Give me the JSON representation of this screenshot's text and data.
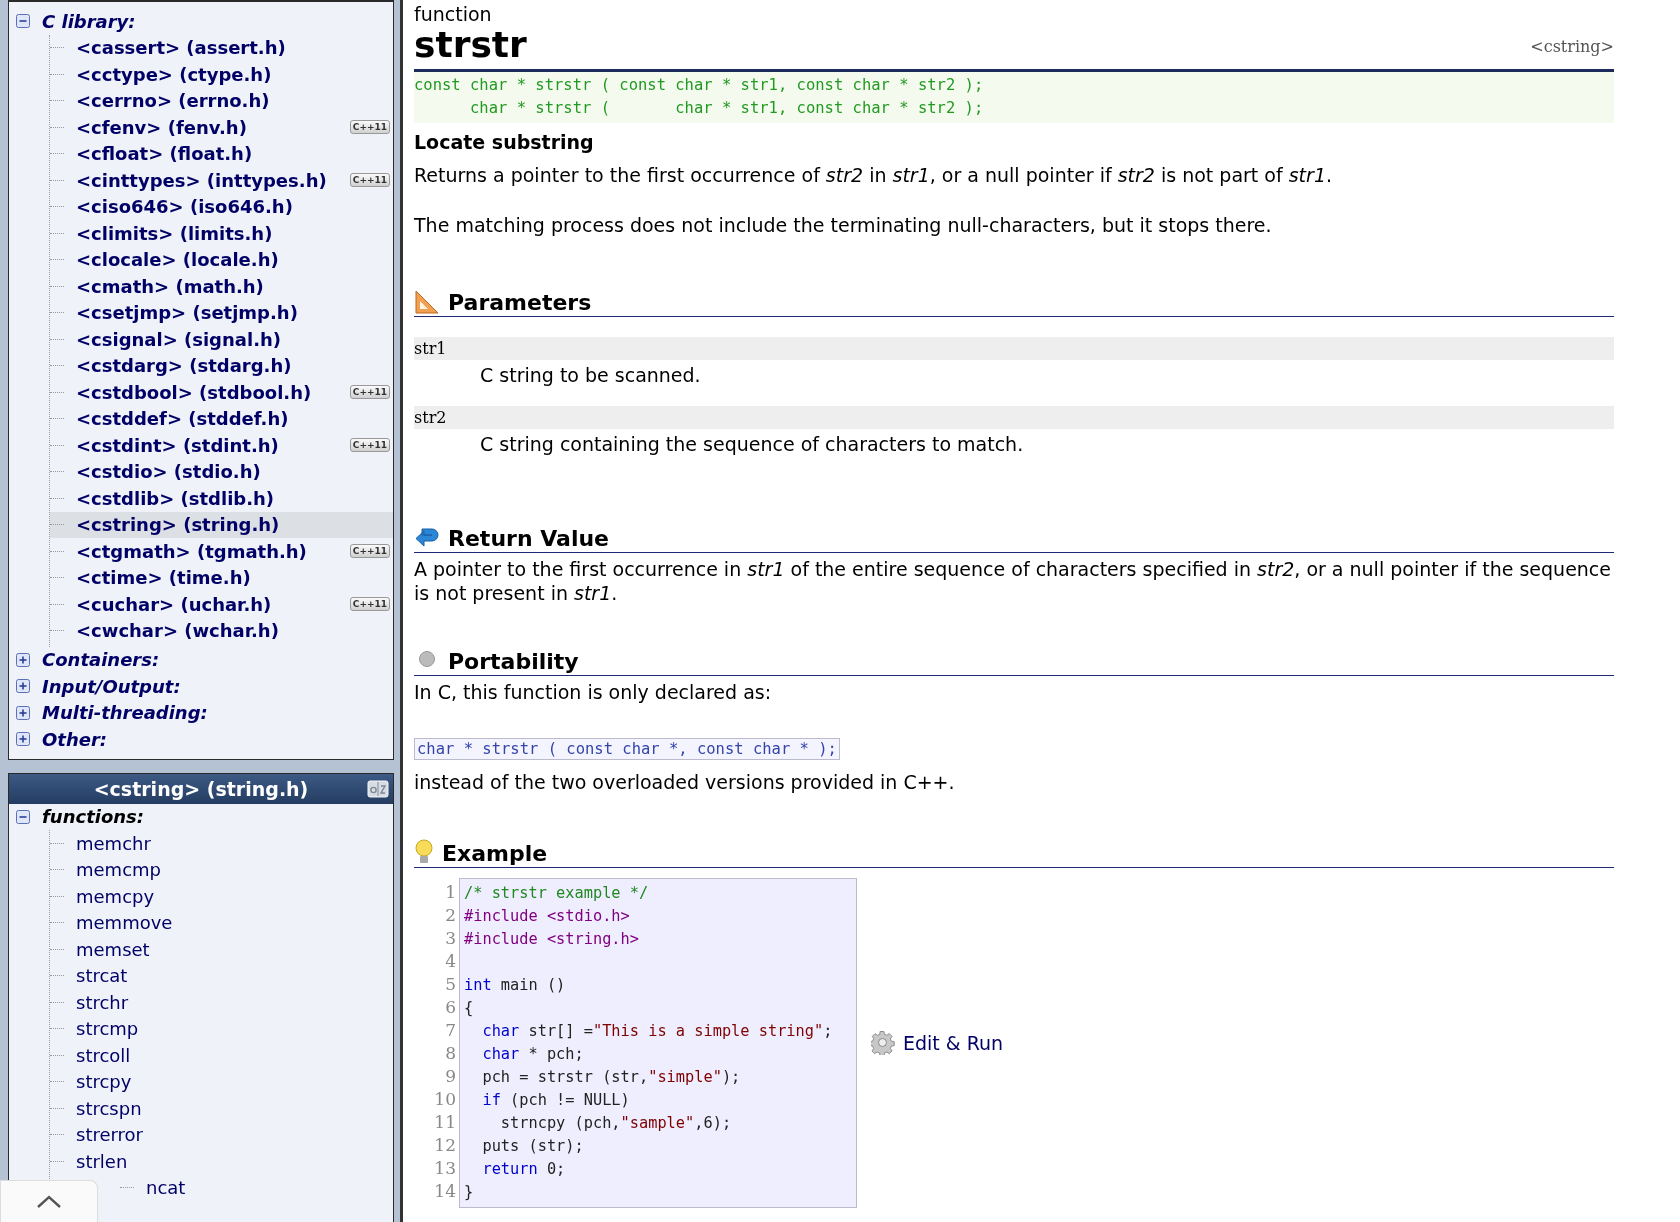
{
  "sidebar": {
    "library_tree": [
      {
        "label": "C library:",
        "expanded": true,
        "children": [
          {
            "label": "<cassert> (assert.h)",
            "selected": false
          },
          {
            "label": "<cctype> (ctype.h)",
            "selected": false
          },
          {
            "label": "<cerrno> (errno.h)",
            "selected": false
          },
          {
            "label": "<cfenv> (fenv.h)",
            "selected": false,
            "badge": "C++11"
          },
          {
            "label": "<cfloat> (float.h)",
            "selected": false
          },
          {
            "label": "<cinttypes> (inttypes.h)",
            "selected": false,
            "badge": "C++11"
          },
          {
            "label": "<ciso646> (iso646.h)",
            "selected": false
          },
          {
            "label": "<climits> (limits.h)",
            "selected": false
          },
          {
            "label": "<clocale> (locale.h)",
            "selected": false
          },
          {
            "label": "<cmath> (math.h)",
            "selected": false
          },
          {
            "label": "<csetjmp> (setjmp.h)",
            "selected": false
          },
          {
            "label": "<csignal> (signal.h)",
            "selected": false
          },
          {
            "label": "<cstdarg> (stdarg.h)",
            "selected": false
          },
          {
            "label": "<cstdbool> (stdbool.h)",
            "selected": false,
            "badge": "C++11"
          },
          {
            "label": "<cstddef> (stddef.h)",
            "selected": false
          },
          {
            "label": "<cstdint> (stdint.h)",
            "selected": false,
            "badge": "C++11"
          },
          {
            "label": "<cstdio> (stdio.h)",
            "selected": false
          },
          {
            "label": "<cstdlib> (stdlib.h)",
            "selected": false
          },
          {
            "label": "<cstring> (string.h)",
            "selected": true
          },
          {
            "label": "<ctgmath> (tgmath.h)",
            "selected": false,
            "badge": "C++11"
          },
          {
            "label": "<ctime> (time.h)",
            "selected": false
          },
          {
            "label": "<cuchar> (uchar.h)",
            "selected": false,
            "badge": "C++11"
          },
          {
            "label": "<cwchar> (wchar.h)",
            "selected": false
          }
        ]
      },
      {
        "label": "Containers:",
        "expanded": false
      },
      {
        "label": "Input/Output:",
        "expanded": false
      },
      {
        "label": "Multi-threading:",
        "expanded": false
      },
      {
        "label": "Other:",
        "expanded": false
      }
    ],
    "reference_panel": {
      "title": "<cstring> (string.h)",
      "groups": [
        {
          "label": "functions:",
          "expanded": true,
          "children": [
            {
              "label": "memchr"
            },
            {
              "label": "memcmp"
            },
            {
              "label": "memcpy"
            },
            {
              "label": "memmove"
            },
            {
              "label": "memset"
            },
            {
              "label": "strcat"
            },
            {
              "label": "strchr"
            },
            {
              "label": "strcmp"
            },
            {
              "label": "strcoll"
            },
            {
              "label": "strcpy"
            },
            {
              "label": "strcspn"
            },
            {
              "label": "strerror"
            },
            {
              "label": "strlen"
            },
            {
              "label": "ncat"
            }
          ]
        }
      ]
    }
  },
  "main": {
    "kind_label": "function",
    "title": "strstr",
    "header_tag": "<cstring>",
    "prototypes": [
      "const char * strstr ( const char * str1, const char * str2 );",
      "      char * strstr (       char * str1, const char * str2 );"
    ],
    "summary": "Locate substring",
    "description": [
      "Returns a pointer to the first occurrence of *str2* in *str1*, or a null pointer if *str2* is not part of *str1*.",
      "The matching process does not include the terminating null-characters, but it stops there."
    ],
    "parameters": {
      "heading": "Parameters",
      "items": [
        {
          "name": "str1",
          "description": "C string to be scanned."
        },
        {
          "name": "str2",
          "description": "C string containing the sequence of characters to match."
        }
      ]
    },
    "return_value": {
      "heading": "Return Value",
      "text": "A pointer to the first occurrence in *str1* of the entire sequence of characters specified in *str2*, or a null pointer if the sequence is not present in *str1*."
    },
    "portability": {
      "heading": "Portability",
      "intro": "In C, this function is only declared as:",
      "code": "char * strstr ( const char *, const char * );",
      "outro": "instead of the two overloaded versions provided in C++."
    },
    "example": {
      "heading": "Example",
      "edit_button": "Edit & Run",
      "lines": [
        {
          "number": "1",
          "tokens": [
            {
              "kind": "comment",
              "text": "/* strstr example */"
            }
          ]
        },
        {
          "number": "2",
          "tokens": [
            {
              "kind": "preprocessor",
              "text": "#include <stdio.h>"
            }
          ]
        },
        {
          "number": "3",
          "tokens": [
            {
              "kind": "preprocessor",
              "text": "#include <string.h>"
            }
          ]
        },
        {
          "number": "4"
        },
        {
          "number": "5",
          "tokens": [
            {
              "kind": "keyword",
              "text": "int"
            },
            {
              "kind": "plain",
              "text": " main ()"
            }
          ]
        },
        {
          "number": "6",
          "tokens": [
            {
              "kind": "plain",
              "text": "{"
            }
          ]
        },
        {
          "number": "7",
          "tokens": [
            {
              "kind": "keyword",
              "text": "  char"
            },
            {
              "kind": "plain",
              "text": " str[] ="
            },
            {
              "kind": "string",
              "text": "\"This is a simple string\""
            },
            {
              "kind": "plain",
              "text": ";"
            }
          ]
        },
        {
          "number": "8",
          "tokens": [
            {
              "kind": "keyword",
              "text": "  char"
            },
            {
              "kind": "plain",
              "text": " * pch;"
            }
          ]
        },
        {
          "number": "9",
          "tokens": [
            {
              "kind": "plain",
              "text": "  pch = strstr (str,"
            },
            {
              "kind": "string",
              "text": "\"simple\""
            },
            {
              "kind": "plain",
              "text": ");"
            }
          ]
        },
        {
          "number": "10",
          "tokens": [
            {
              "kind": "keyword",
              "text": "  if"
            },
            {
              "kind": "plain",
              "text": " (pch != NULL)"
            }
          ]
        },
        {
          "number": "11",
          "tokens": [
            {
              "kind": "plain",
              "text": "    strncpy (pch,"
            },
            {
              "kind": "string",
              "text": "\"sample\""
            },
            {
              "kind": "plain",
              "text": ",6);"
            }
          ]
        },
        {
          "number": "12",
          "tokens": [
            {
              "kind": "plain",
              "text": "  puts (str);"
            }
          ]
        },
        {
          "number": "13",
          "tokens": [
            {
              "kind": "keyword",
              "text": "  return"
            },
            {
              "kind": "plain",
              "text": " 0;"
            }
          ]
        },
        {
          "number": "14",
          "tokens": [
            {
              "kind": "plain",
              "text": "}"
            }
          ]
        }
      ]
    }
  }
}
